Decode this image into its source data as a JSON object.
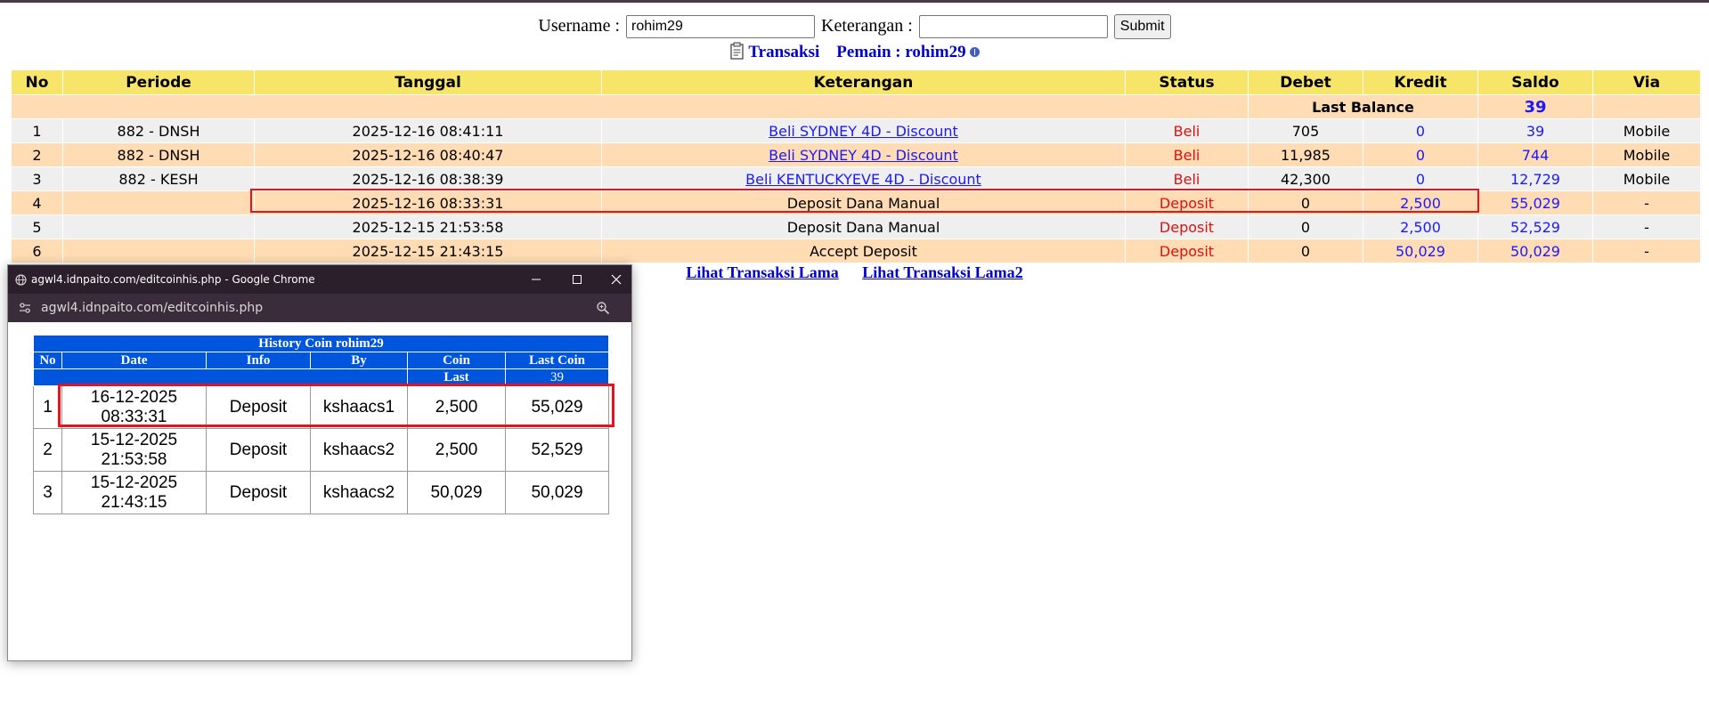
{
  "form": {
    "username_label": "Username :",
    "username_value": "rohim29",
    "keterangan_label": "Keterangan :",
    "keterangan_value": "",
    "submit_label": "Submit"
  },
  "title": {
    "transaksi": "Transaksi",
    "pemain": "Pemain : rohim29"
  },
  "table": {
    "headers": [
      "No",
      "Periode",
      "Tanggal",
      "Keterangan",
      "Status",
      "Debet",
      "Kredit",
      "Saldo",
      "Via"
    ],
    "last_balance_label": "Last Balance",
    "last_balance_value": "39",
    "rows": [
      {
        "no": "1",
        "periode": "882 - DNSH",
        "tanggal": "2025-12-16 08:41:11",
        "keterangan": "Beli SYDNEY 4D - Discount",
        "status": "Beli",
        "debet": "705",
        "kredit": "0",
        "saldo": "39",
        "via": "Mobile"
      },
      {
        "no": "2",
        "periode": "882 - DNSH",
        "tanggal": "2025-12-16 08:40:47",
        "keterangan": "Beli SYDNEY 4D - Discount",
        "status": "Beli",
        "debet": "11,985",
        "kredit": "0",
        "saldo": "744",
        "via": "Mobile"
      },
      {
        "no": "3",
        "periode": "882 - KESH",
        "tanggal": "2025-12-16 08:38:39",
        "keterangan": "Beli KENTUCKYEVE 4D - Discount",
        "status": "Beli",
        "debet": "42,300",
        "kredit": "0",
        "saldo": "12,729",
        "via": "Mobile"
      },
      {
        "no": "4",
        "periode": "",
        "tanggal": "2025-12-16 08:33:31",
        "keterangan": "Deposit Dana Manual",
        "status": "Deposit",
        "debet": "0",
        "kredit": "2,500",
        "saldo": "55,029",
        "via": "-"
      },
      {
        "no": "5",
        "periode": "",
        "tanggal": "2025-12-15 21:53:58",
        "keterangan": "Deposit Dana Manual",
        "status": "Deposit",
        "debet": "0",
        "kredit": "2,500",
        "saldo": "52,529",
        "via": "-"
      },
      {
        "no": "6",
        "periode": "",
        "tanggal": "2025-12-15 21:43:15",
        "keterangan": "Accept Deposit",
        "status": "Deposit",
        "debet": "0",
        "kredit": "50,029",
        "saldo": "50,029",
        "via": "-"
      }
    ]
  },
  "links": {
    "lama": "Lihat Transaksi Lama",
    "lama2": "Lihat Transaksi Lama2"
  },
  "popup": {
    "window_title": "agwl4.idnpaito.com/editcoinhis.php - Google Chrome",
    "url": "agwl4.idnpaito.com/editcoinhis.php",
    "table_title": "History Coin rohim29",
    "headers": [
      "No",
      "Date",
      "Info",
      "By",
      "Coin",
      "Last Coin"
    ],
    "last_label": "Last",
    "last_value": "39",
    "rows": [
      {
        "no": "1",
        "date": "16-12-2025",
        "time": "08:33:31",
        "info": "Deposit",
        "by": "kshaacs1",
        "coin": "2,500",
        "last_coin": "55,029"
      },
      {
        "no": "2",
        "date": "15-12-2025",
        "time": "21:53:58",
        "info": "Deposit",
        "by": "kshaacs2",
        "coin": "2,500",
        "last_coin": "52,529"
      },
      {
        "no": "3",
        "date": "15-12-2025",
        "time": "21:43:15",
        "info": "Deposit",
        "by": "kshaacs2",
        "coin": "50,029",
        "last_coin": "50,029"
      }
    ]
  },
  "colors": {
    "header_bg": "#f7e56a",
    "row_odd": "#efefef",
    "row_even": "#ffdcb4",
    "highlight": "#e8121b",
    "popup_header": "#0055dd"
  }
}
